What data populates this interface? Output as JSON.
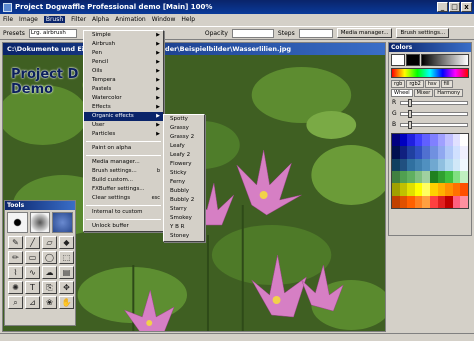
{
  "window": {
    "title": "Project Dogwaffle Professional demo  [Main]  100%",
    "buttons": [
      "_",
      "□",
      "x"
    ]
  },
  "menubar": [
    "File",
    "Image",
    "Brush",
    "Filter",
    "Alpha",
    "Animation",
    "Window",
    "Help"
  ],
  "menubar_active": "Brush",
  "toolbar": {
    "presets_label": "Presets",
    "preset_value": "Lrg. airbrush",
    "opacity_label": "Opacity",
    "steps_label": "Steps",
    "media_manager": "Media manager...",
    "brush_settings": "Brush settings..."
  },
  "document": {
    "title": "C:\\Dokumente und Ein... umente\\Eigene Bilder\\Beispielbilder\\Wasserlilien.jpg",
    "brand_line1": "Project D",
    "brand_line2": "Demo"
  },
  "brush_menu": {
    "items": [
      {
        "label": "Simple",
        "arrow": true
      },
      {
        "label": "Airbrush",
        "arrow": true
      },
      {
        "label": "Pen",
        "arrow": true
      },
      {
        "label": "Pencil",
        "arrow": true
      },
      {
        "label": "Oils",
        "arrow": true
      },
      {
        "label": "Tempera",
        "arrow": true
      },
      {
        "label": "Pastels",
        "arrow": true
      },
      {
        "label": "Watercolor",
        "arrow": true
      },
      {
        "label": "Effects",
        "arrow": true
      },
      {
        "label": "Organic effects",
        "arrow": true,
        "highlight": true
      },
      {
        "label": "User",
        "arrow": true
      },
      {
        "label": "Particles",
        "arrow": true
      }
    ],
    "group2": [
      "Paint on alpha"
    ],
    "group3": [
      "Media manager...",
      "Brush settings...",
      "Build custom...",
      "FXBuffer settings...",
      "Clear settings"
    ],
    "shortcuts": {
      "Brush settings...": "b",
      "Clear settings": "esc"
    },
    "group4": [
      "Internal to custom"
    ],
    "group5": [
      "Unlock buffer"
    ]
  },
  "organic_submenu": [
    "Spotty",
    "Grassy",
    "Grassy 2",
    "Leafy",
    "Leafy 2",
    "Flowery",
    "Sticky",
    "Ferny",
    "Bubbly",
    "Bubbly 2",
    "Starry",
    "Smokey",
    "Y B R",
    "Stoney"
  ],
  "tools_panel": {
    "title": "Tools"
  },
  "tools_icons": [
    "brush-tool-icon",
    "line-tool-icon",
    "eraser-tool-icon",
    "fill-tool-icon",
    "pencil-tool-icon",
    "rect-tool-icon",
    "ellipse-tool-icon",
    "select-tool-icon",
    "lasso-tool-icon",
    "curve-tool-icon",
    "smudge-tool-icon",
    "gradient-tool-icon",
    "spray-tool-icon",
    "text-tool-icon",
    "clone-tool-icon",
    "move-tool-icon",
    "zoom-tool-icon",
    "dropper-tool-icon",
    "warp-tool-icon",
    "hand-tool-icon"
  ],
  "tools_glyphs": [
    "✎",
    "╱",
    "▱",
    "◆",
    "✏",
    "▭",
    "◯",
    "⬚",
    "⌇",
    "∿",
    "☁",
    "▤",
    "✺",
    "T",
    "⎘",
    "✥",
    "⌕",
    "⊿",
    "❀",
    "✋"
  ],
  "colors_panel": {
    "title": "Colors",
    "tabs": [
      "rgb",
      "rgb2",
      "hsv",
      "fill",
      "Wheel",
      "Mixer",
      "Harmony"
    ],
    "sliders": [
      "R",
      "G",
      "B"
    ],
    "slider_levels": [
      0.1,
      0.1,
      0.1
    ]
  },
  "palette_colors": [
    "#000080",
    "#0000c0",
    "#2020e0",
    "#4040ff",
    "#6060ff",
    "#8080ff",
    "#a0a0ff",
    "#c0c0ff",
    "#e0e0ff",
    "#ffffff",
    "#001050",
    "#102080",
    "#2040a0",
    "#3050c0",
    "#5070d0",
    "#7090e0",
    "#90a8f0",
    "#b0c8f8",
    "#d0e0ff",
    "#f0f0ff",
    "#104060",
    "#205080",
    "#3070a0",
    "#4080b0",
    "#5090c0",
    "#70a8d0",
    "#90c0e0",
    "#b0d8f0",
    "#d0e8f8",
    "#f0f8ff",
    "#408040",
    "#50a050",
    "#60b060",
    "#80c080",
    "#a0d0a0",
    "#208020",
    "#30a030",
    "#40c040",
    "#80e080",
    "#c0f0c0",
    "#a0a000",
    "#c0c000",
    "#e0e000",
    "#ffff00",
    "#ffff60",
    "#ffd000",
    "#ffb000",
    "#ff9000",
    "#ff7000",
    "#ff5000",
    "#c04000",
    "#e05000",
    "#ff6000",
    "#ff8020",
    "#ffa040",
    "#ff4040",
    "#e02020",
    "#c00000",
    "#ff6080",
    "#ff90a0"
  ],
  "colors": {
    "accent": "#0a246a",
    "face": "#d4d0c8"
  }
}
